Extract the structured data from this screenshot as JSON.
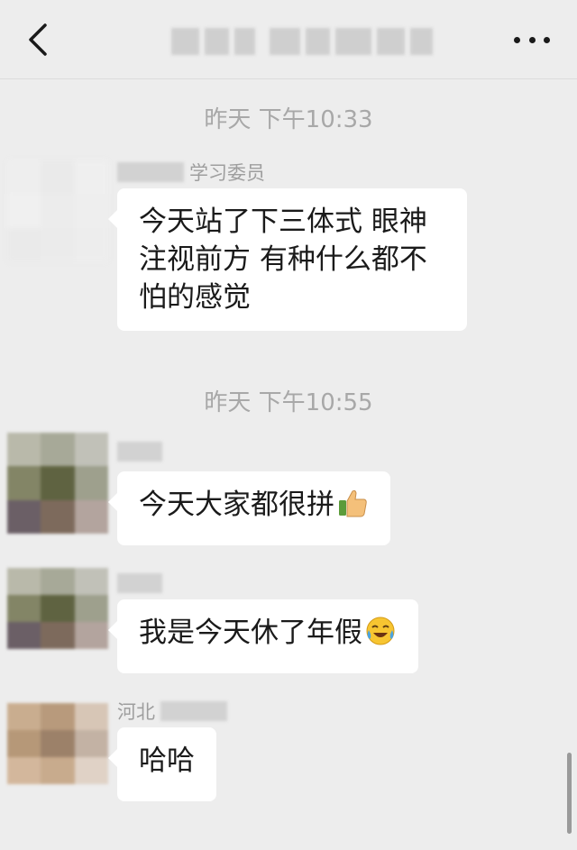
{
  "header": {
    "back_icon": "chevron-left-icon",
    "more_icon": "more-dots-icon"
  },
  "messages": [
    {
      "time": "昨天 下午10:33"
    },
    {
      "nick_suffix": "学习委员",
      "text": "今天站了下三体式  眼神注视前方  有种什么都不怕的感觉"
    },
    {
      "time": "昨天 下午10:55"
    },
    {
      "nick_suffix": "",
      "text": "今天大家都很拼",
      "emoji": "thumbs-up-icon"
    },
    {
      "nick_suffix": "",
      "text": "我是今天休了年假",
      "emoji": "laughing-crying-icon"
    },
    {
      "nick_prefix": "河北",
      "text": "哈哈"
    }
  ],
  "colors": {
    "background": "#ededed",
    "bubble": "#ffffff",
    "timestamp": "#a8a8a8",
    "nickname": "#9e9e9e"
  }
}
